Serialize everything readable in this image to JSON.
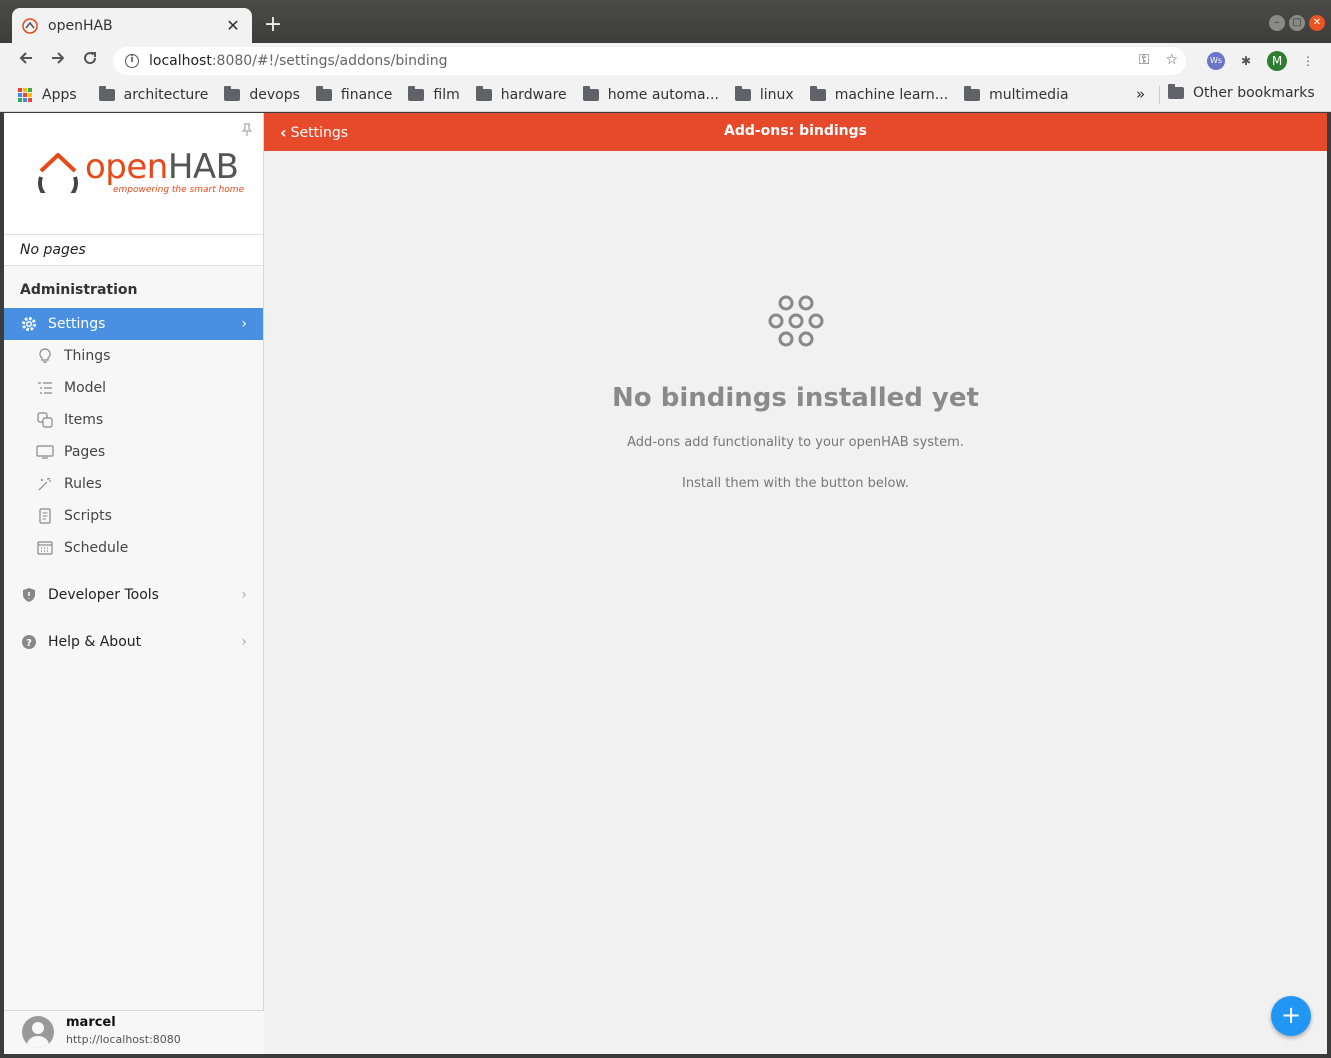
{
  "browser": {
    "tab_title": "openHAB",
    "tab_close": "✕",
    "new_tab": "+",
    "url_host": "localhost",
    "url_path": ":8080/#!/settings/addons/binding",
    "profile_initial": "M",
    "bookmarks": [
      {
        "label": "Apps",
        "icon": "apps-grid-icon"
      },
      {
        "label": "architecture",
        "icon": "folder-icon"
      },
      {
        "label": "devops",
        "icon": "folder-icon"
      },
      {
        "label": "finance",
        "icon": "folder-icon"
      },
      {
        "label": "film",
        "icon": "folder-icon"
      },
      {
        "label": "hardware",
        "icon": "folder-icon"
      },
      {
        "label": "home automa...",
        "icon": "folder-icon"
      },
      {
        "label": "linux",
        "icon": "folder-icon"
      },
      {
        "label": "machine learn...",
        "icon": "folder-icon"
      },
      {
        "label": "multimedia",
        "icon": "folder-icon"
      }
    ],
    "bookmarks_more": "»",
    "other_bookmarks": "Other bookmarks"
  },
  "panel": {
    "logo_open": "open",
    "logo_hab": "HAB",
    "logo_tagline": "empowering the smart home",
    "no_pages": "No pages",
    "section_title": "Administration",
    "settings_label": "Settings",
    "sub_items": [
      {
        "label": "Things",
        "icon": "lightbulb-icon"
      },
      {
        "label": "Model",
        "icon": "list-tree-icon"
      },
      {
        "label": "Items",
        "icon": "items-icon"
      },
      {
        "label": "Pages",
        "icon": "monitor-icon"
      },
      {
        "label": "Rules",
        "icon": "wand-icon"
      },
      {
        "label": "Scripts",
        "icon": "document-icon"
      },
      {
        "label": "Schedule",
        "icon": "calendar-icon"
      }
    ],
    "developer_tools": "Developer Tools",
    "help_about": "Help & About",
    "user_name": "marcel",
    "user_url": "http://localhost:8080"
  },
  "main": {
    "back_label": "Settings",
    "title": "Add-ons: bindings",
    "empty_title": "No bindings installed yet",
    "empty_text1": "Add-ons add functionality to your openHAB system.",
    "empty_text2": "Install them with the button below.",
    "fab_label": "+"
  },
  "colors": {
    "navbar": "#e64a2a",
    "accent_active": "#4a90e2",
    "fab": "#2196f3"
  }
}
